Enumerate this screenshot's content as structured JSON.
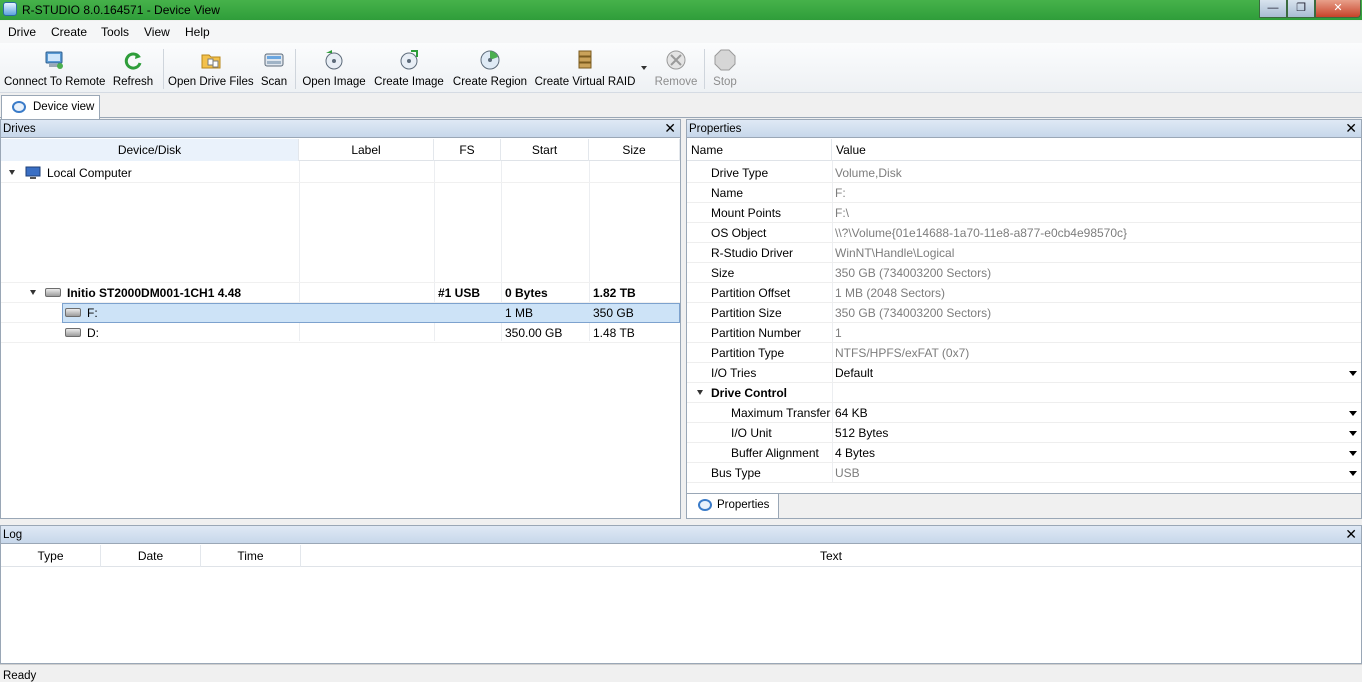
{
  "window": {
    "title": "R-STUDIO 8.0.164571 - Device View"
  },
  "menu": [
    "Drive",
    "Create",
    "Tools",
    "View",
    "Help"
  ],
  "toolbar": {
    "connect_remote": "Connect To Remote",
    "refresh": "Refresh",
    "open_drive_files": "Open Drive Files",
    "scan": "Scan",
    "open_image": "Open Image",
    "create_image": "Create Image",
    "create_region": "Create Region",
    "create_virtual_raid": "Create Virtual RAID",
    "remove": "Remove",
    "stop": "Stop"
  },
  "tabs": {
    "device_view": "Device view",
    "properties": "Properties"
  },
  "drives": {
    "title": "Drives",
    "columns": [
      "Device/Disk",
      "Label",
      "FS",
      "Start",
      "Size"
    ],
    "local_computer": "Local Computer",
    "disk": {
      "name": "Initio ST2000DM001-1CH1 4.48",
      "fs": "#1 USB",
      "start": "0 Bytes",
      "size": "1.82 TB"
    },
    "partitions": [
      {
        "name": "F:",
        "start": "1 MB",
        "size": "350 GB"
      },
      {
        "name": "D:",
        "start": "350.00 GB",
        "size": "1.48 TB"
      }
    ]
  },
  "properties": {
    "title": "Properties",
    "columns": [
      "Name",
      "Value"
    ],
    "rows": [
      {
        "name": "Drive Type",
        "value": "Volume,Disk"
      },
      {
        "name": "Name",
        "value": "F:"
      },
      {
        "name": "Mount Points",
        "value": "F:\\"
      },
      {
        "name": "OS Object",
        "value": "\\\\?\\Volume{01e14688-1a70-11e8-a877-e0cb4e98570c}"
      },
      {
        "name": "R-Studio Driver",
        "value": "WinNT\\Handle\\Logical"
      },
      {
        "name": "Size",
        "value": "350 GB (734003200 Sectors)"
      },
      {
        "name": "Partition Offset",
        "value": "1 MB (2048 Sectors)"
      },
      {
        "name": "Partition Size",
        "value": "350 GB (734003200 Sectors)"
      },
      {
        "name": "Partition Number",
        "value": "1"
      },
      {
        "name": "Partition Type",
        "value": "NTFS/HPFS/exFAT (0x7)"
      },
      {
        "name": "I/O Tries",
        "value": "Default"
      },
      {
        "name": "Drive Control",
        "value": ""
      },
      {
        "name": "Maximum Transfer",
        "value": "64 KB"
      },
      {
        "name": "I/O Unit",
        "value": "512 Bytes"
      },
      {
        "name": "Buffer Alignment",
        "value": "4 Bytes"
      },
      {
        "name": "Bus Type",
        "value": "USB"
      }
    ]
  },
  "log": {
    "title": "Log",
    "columns": [
      "Type",
      "Date",
      "Time",
      "Text"
    ]
  },
  "status": "Ready",
  "colors": {
    "titlebar": "#3aa83f",
    "selection": "#cde3f7",
    "header": "#d5e2f1"
  }
}
